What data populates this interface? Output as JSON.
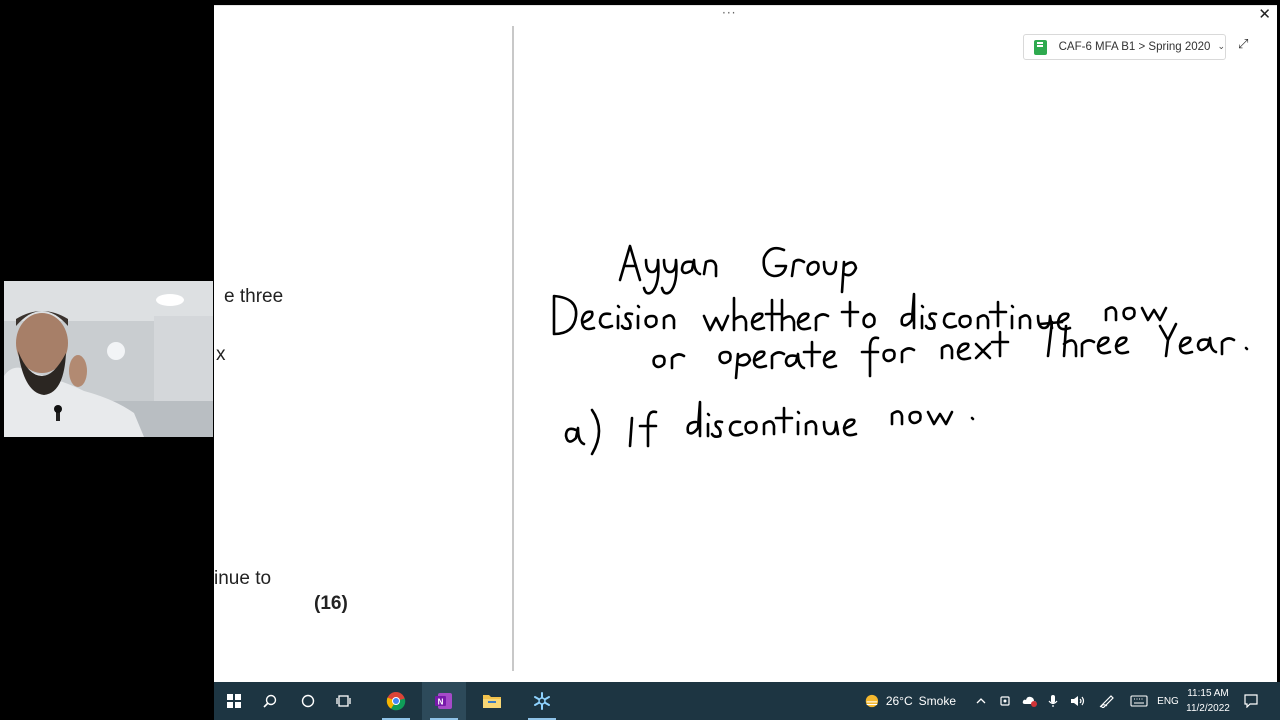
{
  "window": {
    "title_dots": "···",
    "close_glyph": "✕"
  },
  "document": {
    "fragment_1": "e three",
    "fragment_2": "x",
    "fragment_3": "inue to",
    "marks": "(16)"
  },
  "notebook": {
    "label": "CAF-6 MFA B1 > Spring 2020",
    "icon": "notebook-icon",
    "chevron": "⌄",
    "expand_glyph": "⤢"
  },
  "ink": {
    "line_1": "Ayyan Group",
    "line_2": "Decision whether to discontinue now",
    "line_3": "or operate for next Three Years.",
    "line_4": "a) If discontinue now."
  },
  "taskbar": {
    "weather_temp": "26°C",
    "weather_desc": "Smoke",
    "language": "ENG",
    "time": "11:15 AM",
    "date": "11/2/2022",
    "accent_color": "#1d3542"
  }
}
